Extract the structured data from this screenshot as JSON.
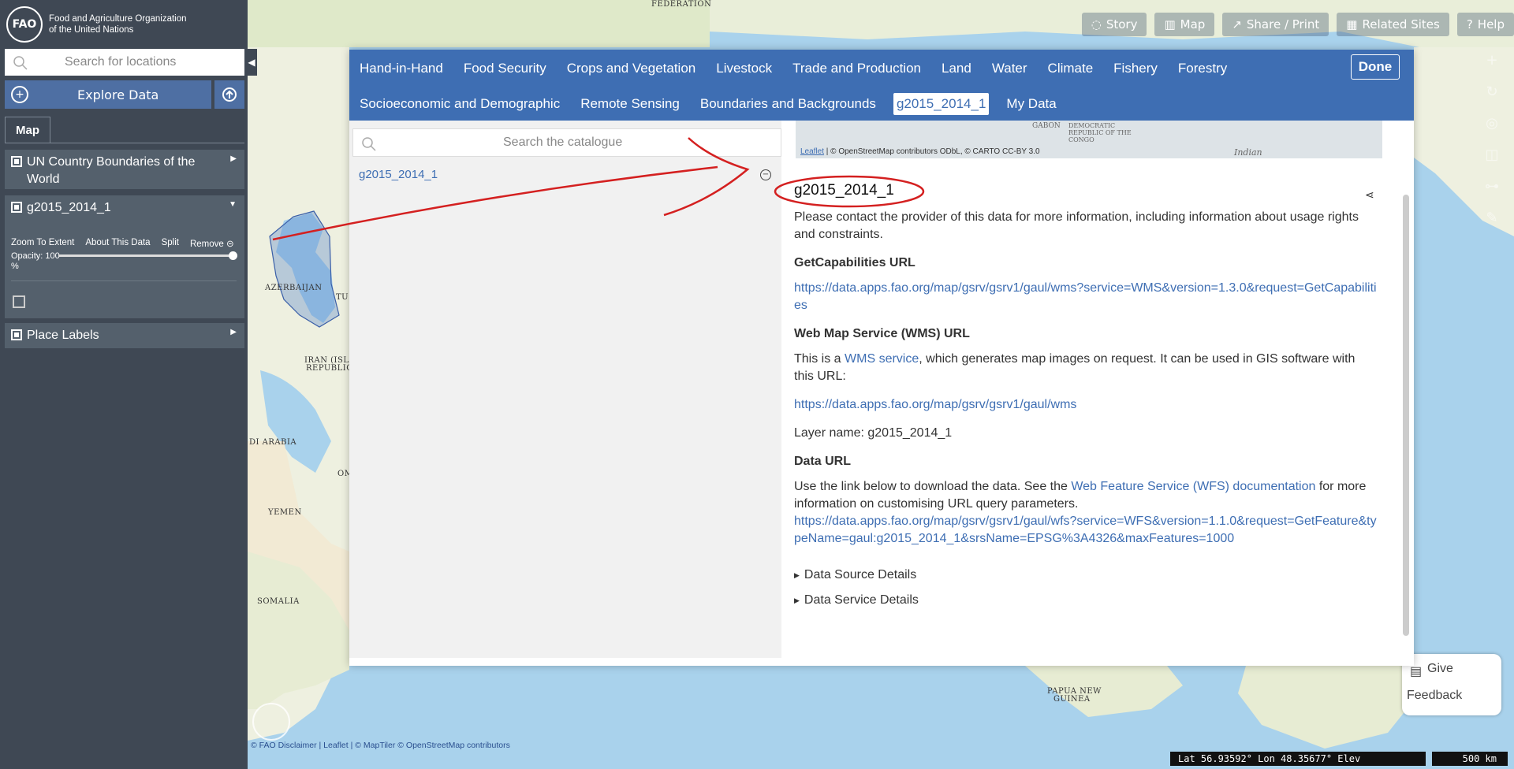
{
  "map": {
    "labels": [
      "FEDERATION",
      "AZERBAIJAN",
      "TU",
      "IRAN (ISLA",
      "REPUBLIC",
      "OM",
      "DI ARABIA",
      "YEMEN",
      "SOMALIA",
      "PAPUA NEW",
      "GUINEA"
    ],
    "top_buttons": [
      {
        "label": "Story",
        "icon": "story-icon"
      },
      {
        "label": "Map",
        "icon": "map-icon"
      },
      {
        "label": "Share / Print",
        "icon": "share-icon"
      },
      {
        "label": "Related Sites",
        "icon": "grid-icon"
      },
      {
        "label": "Help",
        "icon": "help-icon"
      }
    ],
    "attribution": {
      "disclaimer": "© FAO Disclaimer",
      "leaflet": "Leaflet",
      "rest": "© MapTiler © OpenStreetMap contributors"
    },
    "coords": "Lat  56.93592° Lon  48.35677° Elev",
    "scale": "500 km",
    "feedback": {
      "line1": "Give",
      "line2": "Feedback"
    }
  },
  "sidebar": {
    "logo_initials": "FAO",
    "org_line1": "Food and Agriculture Organization",
    "org_line2": "of the United Nations",
    "search_placeholder": "Search for locations",
    "explore_label": "Explore Data",
    "map_tab": "Map",
    "layers": [
      {
        "name_line1": "UN Country Boundaries of the",
        "name_line2": "World"
      },
      {
        "name_line1": "g2015_2014_1",
        "name_line2": ""
      },
      {
        "name_line1": "Place Labels",
        "name_line2": ""
      }
    ],
    "layer_controls": [
      "Zoom To Extent",
      "About This Data",
      "Split",
      "Remove"
    ],
    "opacity_label": "Opacity: 100",
    "opacity_unit": "%",
    "opacity_value": 100
  },
  "modal": {
    "nav_row1": [
      "Hand-in-Hand",
      "Food Security",
      "Crops and Vegetation",
      "Livestock",
      "Trade and Production",
      "Land",
      "Water",
      "Climate",
      "Fishery",
      "Forestry"
    ],
    "nav_row2": [
      "Socioeconomic and Demographic",
      "Remote Sensing",
      "Boundaries and Backgrounds",
      "g2015_2014_1",
      "My Data"
    ],
    "active_tab": "g2015_2014_1",
    "done_label": "Done",
    "catalog_search_placeholder": "Search the catalogue",
    "catalog_item": "g2015_2014_1",
    "preview": {
      "leaflet": "Leaflet",
      "attribution": " | © OpenStreetMap contributors ODbL, © CARTO CC-BY 3.0",
      "label_gabon": "GABON",
      "label_drc": "DEMOCRATIC REPUBLIC OF THE CONGO",
      "label_indian": "Indian"
    },
    "title": "g2015_2014_1",
    "intro": "Please contact the provider of this data for more information, including information about usage rights and constraints.",
    "getcap_heading": "GetCapabilities URL",
    "getcap_url": "https://data.apps.fao.org/map/gsrv/gsrv1/gaul/wms?service=WMS&version=1.3.0&request=GetCapabilities",
    "wms_heading": "Web Map Service (WMS) URL",
    "wms_text_pre": "This is a ",
    "wms_link": "WMS service",
    "wms_text_post": ", which generates map images on request. It can be used in GIS software with this URL:",
    "wms_url": "https://data.apps.fao.org/map/gsrv/gsrv1/gaul/wms",
    "layer_name": "Layer name: g2015_2014_1",
    "data_heading": "Data URL",
    "data_text_pre": "Use the link below to download the data. See the ",
    "data_link": "Web Feature Service (WFS) documentation",
    "data_text_post": " for more information on customising URL query parameters.",
    "data_url": "https://data.apps.fao.org/map/gsrv/gsrv1/gaul/wfs?service=WFS&version=1.1.0&request=GetFeature&typeName=gaul:g2015_2014_1&srsName=EPSG%3A4326&maxFeatures=1000",
    "toggle1": "Data Source Details",
    "toggle2": "Data Service Details"
  },
  "colors": {
    "header_blue": "#3e6eb3",
    "sidebar_dark": "#3f4854",
    "annotation_red": "#d42020"
  }
}
